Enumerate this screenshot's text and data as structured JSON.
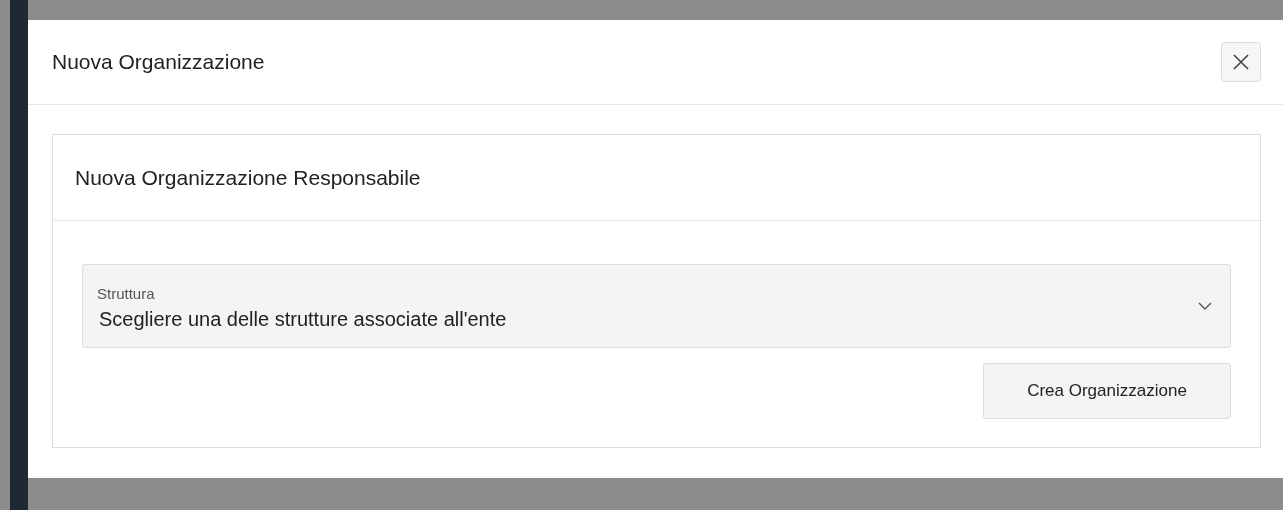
{
  "dialog": {
    "title": "Nuova Organizzazione"
  },
  "card": {
    "title": "Nuova Organizzazione Responsabile"
  },
  "select": {
    "label": "Struttura",
    "placeholder": "Scegliere una delle strutture associate all'ente"
  },
  "buttons": [
    "Crea Organizzazione"
  ]
}
